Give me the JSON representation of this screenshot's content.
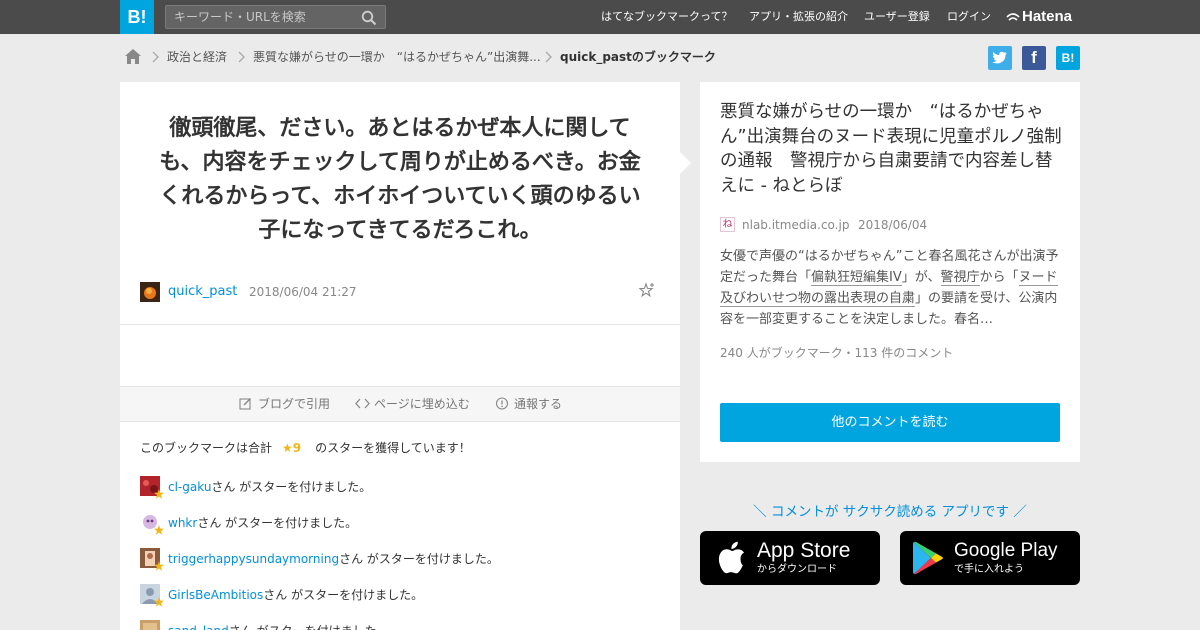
{
  "header": {
    "logo": "B!",
    "search_placeholder": "キーワード・URLを検索",
    "nav": [
      "はてなブックマークって？",
      "アプリ・拡張の紹介",
      "ユーザー登録",
      "ログイン"
    ],
    "brand": "Hatena"
  },
  "breadcrumb": {
    "items": [
      "政治と経済",
      "悪質な嫌がらせの一環か　“はるかぜちゃん”出演舞..."
    ],
    "current": "quick_pastのブックマーク"
  },
  "share": {
    "twitter": "t",
    "facebook": "f",
    "hatena": "B!"
  },
  "bookmark": {
    "comment": "徹頭徹尾、ださい。あとはるかぜ本人に関しても、内容をチェックして周りが止めるべき。お金くれるからって、ホイホイついていく頭のゆるい子になってきてるだろこれ。",
    "user": "quick_past",
    "timestamp": "2018/06/04 21:27"
  },
  "tools": {
    "cite": "ブログで引用",
    "embed": "ページに埋め込む",
    "report": "通報する"
  },
  "stars": {
    "summary_prefix": "このブックマークは合計",
    "count": "★9",
    "summary_suffix": "のスターを獲得しています！",
    "suffix": "さん がスターを付けました。",
    "givers": [
      "cl-gaku",
      "whkr",
      "triggerhappysundaymorning",
      "GirlsBeAmbitios",
      "sand_land"
    ]
  },
  "entry": {
    "title": "悪質な嫌がらせの一環か　“はるかぜちゃん”出演舞台のヌード表現に児童ポルノ強制の通報　警視庁から自粛要請で内容差し替えに - ねとらぼ",
    "favicon": "ね",
    "domain": "nlab.itmedia.co.jp",
    "date": "2018/06/04",
    "summary_1": "女優で声優の“はるかぜちゃん”こと春名風花さんが出演予定だった舞台「",
    "summary_link_1": "偏執狂短編集IV",
    "summary_2": "」が、",
    "summary_link_2": "警視庁",
    "summary_3": "から「",
    "summary_link_3": "ヌード及びわいせつ物の露出表現の自粛",
    "summary_4": "」の要請を受け、公演内容を一部変更することを決定しました。春名…",
    "counts": "240 人がブックマーク・113 件のコメント",
    "read_button": "他のコメントを読む"
  },
  "app": {
    "promo": "＼ コメントが サクサク読める アプリです ／",
    "apple_name": "App Store",
    "apple_sub": "からダウンロード",
    "google_name": "Google Play",
    "google_sub": "で手に入れよう"
  },
  "colors": {
    "brand": "#00a4de",
    "header": "#4b4b4b",
    "background": "#ebebeb",
    "link": "#008fde",
    "star": "#f2b518"
  }
}
